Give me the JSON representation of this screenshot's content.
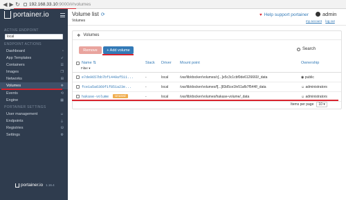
{
  "browser": {
    "url_host": "192.168.33.10",
    "url_path": ":9000/#/volumes",
    "back": "◀",
    "forward": "▶",
    "reload": "↻"
  },
  "sidebar": {
    "logo_text": "portainer.io",
    "section_active_endpoint": "ACTIVE ENDPOINT",
    "endpoint_value": "local",
    "section_endpoint_actions": "ENDPOINT ACTIONS",
    "items": [
      {
        "label": "Dashboard",
        "icon": "tachometer-icon"
      },
      {
        "label": "App Templates",
        "icon": "rocket-icon"
      },
      {
        "label": "Containers",
        "icon": "server-icon"
      },
      {
        "label": "Images",
        "icon": "clone-icon"
      },
      {
        "label": "Networks",
        "icon": "sitemap-icon"
      },
      {
        "label": "Volumes",
        "icon": "cubes-icon"
      },
      {
        "label": "Events",
        "icon": "history-icon"
      },
      {
        "label": "Engine",
        "icon": "th-icon"
      }
    ],
    "section_settings": "PORTAINER SETTINGS",
    "settings_items": [
      {
        "label": "User management",
        "icon": "users-icon"
      },
      {
        "label": "Endpoints",
        "icon": "plug-icon"
      },
      {
        "label": "Registries",
        "icon": "database-icon"
      },
      {
        "label": "Settings",
        "icon": "cogs-icon"
      }
    ],
    "footer_logo": "portainer.io",
    "footer_version": "1.16.4",
    "active_item": "Volumes"
  },
  "header": {
    "title": "Volume list",
    "breadcrumb": "Volumes",
    "help_text": "Help support portainer",
    "username": "admin",
    "my_account": "my account",
    "log_out": "log out"
  },
  "panel": {
    "title": "Volumes",
    "remove_label": "Remove",
    "add_label": "+ Add volume",
    "search_label": "Search",
    "columns": {
      "name": "Name",
      "filter": "Filter",
      "stack": "Stack",
      "driver": "Driver",
      "mountpoint": "Mount point",
      "ownership": "Ownership"
    },
    "rows": [
      {
        "name": "e7de9657bb7bf1449af511...",
        "stack": "-",
        "driver": "local",
        "mountpoint": "/var/lib/docker/volumes/c[...]e5c3c1cbf0de6126660/_data",
        "ownership": "public",
        "unused": ""
      },
      {
        "name": "fce1a5a6369f1f851a23e...",
        "stack": "-",
        "driver": "local",
        "mountpoint": "/var/lib/docker/volumes/f[...]83d5ce1fe51afb7f544f/_data",
        "ownership": "administrators",
        "unused": ""
      },
      {
        "name": "hakase-volume",
        "stack": "-",
        "driver": "local",
        "mountpoint": "/var/lib/docker/volumes/hakase-volume/_data",
        "ownership": "administrators",
        "unused": "Unused"
      }
    ],
    "items_per_page_label": "Items per page",
    "items_per_page_value": "10"
  }
}
